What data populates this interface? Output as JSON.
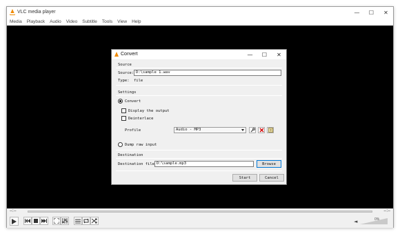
{
  "window": {
    "title": "VLC media player",
    "controls": [
      "—",
      "☐",
      "✕"
    ]
  },
  "menu": [
    "Media",
    "Playback",
    "Audio",
    "Video",
    "Subtitle",
    "Tools",
    "View",
    "Help"
  ],
  "seek": {
    "elapsed": "--:--",
    "total": "--:--"
  },
  "volume": {
    "percent": "0%"
  },
  "dialog": {
    "title": "Convert",
    "source": {
      "heading": "Source",
      "source_label": "Source:",
      "source_value": "D:\\sample 1.wav",
      "type_label": "Type:",
      "type_value": "file"
    },
    "settings": {
      "heading": "Settings",
      "convert_label": "Convert",
      "display_output_label": "Display the output",
      "deinterlace_label": "Deinterlace",
      "profile_label": "Profile",
      "profile_value": "Audio - MP3",
      "dump_raw_label": "Dump raw input"
    },
    "destination": {
      "heading": "Destination",
      "file_label": "Destination file:",
      "file_value": "D:\\sample.mp3",
      "browse_label": "Browse"
    },
    "start_label": "Start",
    "cancel_label": "Cancel"
  },
  "colors": {
    "vlc_orange": "#f08a00",
    "focus_blue": "#0078d7",
    "delete_red": "#d40000"
  }
}
